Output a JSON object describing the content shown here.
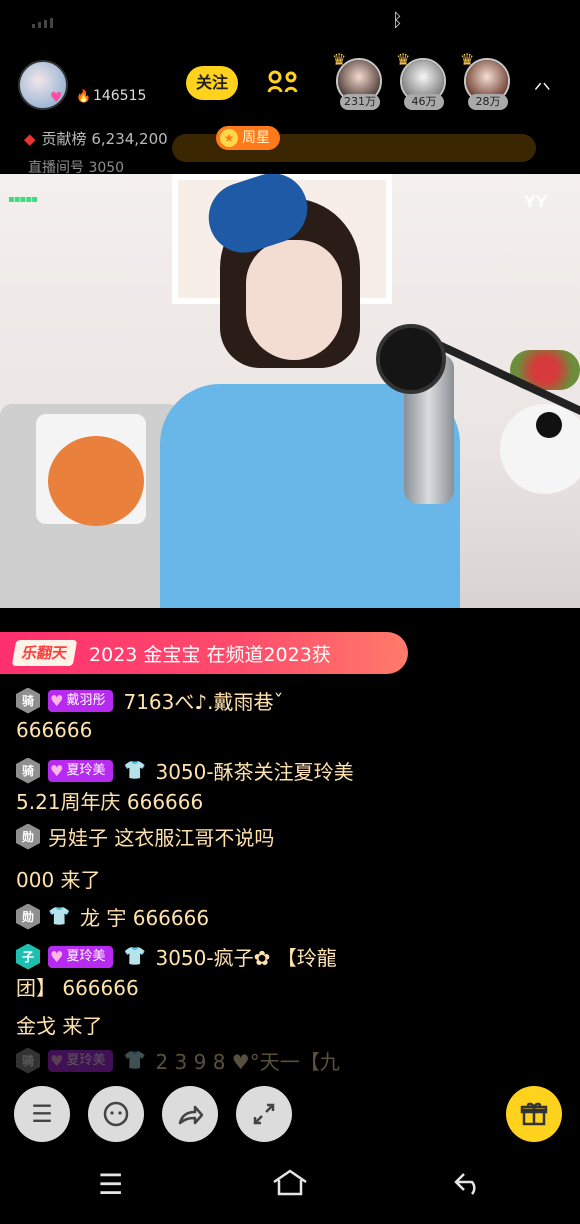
{
  "status_bar": {
    "bluetooth_icon": "bluetooth-icon",
    "signal_icon": "signal-icon"
  },
  "header": {
    "streamer_fans": "146515",
    "follow_label": "关注",
    "link_mic_icon": "link-mic-icon",
    "top_viewers": [
      {
        "amount": "231万"
      },
      {
        "amount": "46万"
      },
      {
        "amount": "28万"
      }
    ],
    "contribution_label": "贡献榜",
    "contribution_value": "6,234,200",
    "week_star_label": "周星",
    "room_id_label": "直播间号",
    "room_id": "3050"
  },
  "video": {
    "watermark": "YY"
  },
  "announcement": {
    "tag": "乐翻天",
    "message": "2023 金宝宝 在频道2023获"
  },
  "chat": {
    "messages": [
      {
        "level_badge": "骑",
        "fan_badge": "戴羽彤",
        "text": "7163べ♪.戴雨巷ˇ"
      },
      {
        "text": "666666"
      },
      {
        "level_badge": "骑",
        "fan_badge": "夏玲美",
        "text": "3050-酥茶关注夏玲美"
      },
      {
        "text": "5.21周年庆 666666"
      },
      {
        "level_badge": "勋",
        "text": "另娃子 这衣服江哥不说吗"
      },
      {
        "text": "000 来了"
      },
      {
        "level_badge": "勋",
        "text": "龙 宇 666666"
      },
      {
        "level_badge": "子",
        "fan_badge": "夏玲美",
        "text": "3050-疯子✿ 【玲龍"
      },
      {
        "text": "团】 666666"
      },
      {
        "text": "金戈 来了"
      },
      {
        "level_badge": "骑",
        "fan_badge": "夏玲美",
        "text": "2 3 9 8 ♥°天一【九"
      }
    ]
  },
  "toolbar": {
    "menu_icon": "menu-icon",
    "chat_icon": "chat-icon",
    "share_icon": "share-icon",
    "fullscreen_icon": "fullscreen-icon",
    "gift_icon": "gift-icon"
  },
  "colors": {
    "accent_yellow": "#ffd21e",
    "chat_text": "#ffe2ad",
    "fan_badge": "#b72bf0",
    "announce": "#ff2f6e"
  }
}
